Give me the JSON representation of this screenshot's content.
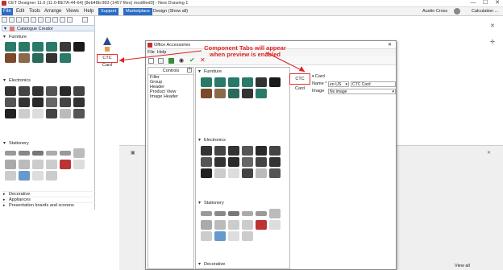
{
  "window": {
    "title": "CET Designer 11.0 (11.0-BETA-44-64) [8eb48b:983 (1457 files) modified0] - New Drawing 1",
    "minimize": "—",
    "maximize": "☐",
    "close": "✕"
  },
  "menubar": {
    "items": [
      "File",
      "Edit",
      "Tools",
      "Arrange",
      "Views",
      "Help"
    ],
    "tabs": [
      "Support",
      "Marketplace"
    ],
    "design_label": "Design (Show all)",
    "user": "Austin Cross",
    "calculation": "Calculation ..."
  },
  "catalogue": {
    "name": "Catalogue Creator"
  },
  "sections": {
    "furniture": "Furniture",
    "electronics": "Electronics",
    "stationery": "Stationery",
    "decorative": "Decorative",
    "appliances": "Appliances",
    "presentation": "Presentation boards and screens"
  },
  "ctc_card": "CTC Card",
  "callout": "Component Tabs will appear when preview is enabled",
  "dialog": {
    "title": "Office Accessories",
    "menu": [
      "File",
      "Help"
    ],
    "controls_header": "Controls",
    "controls": [
      "Filler",
      "Group",
      "Header",
      "Product View",
      "Image Header"
    ],
    "preview_sections": {
      "furniture": "Furniture",
      "electronics": "Electronics",
      "stationery": "Stationery",
      "decorative": "Decorative"
    },
    "props": {
      "card_header": "Card",
      "name_label": "Name *",
      "locale": "en-US",
      "name_value": "CTC Card",
      "image_label": "Image",
      "image_value": "No image"
    }
  },
  "status": {
    "view_all": "View all"
  },
  "colors": {
    "accent": "#2b6cc4",
    "callout": "#dd2222",
    "furniture_teal": "#2a7a6a"
  }
}
